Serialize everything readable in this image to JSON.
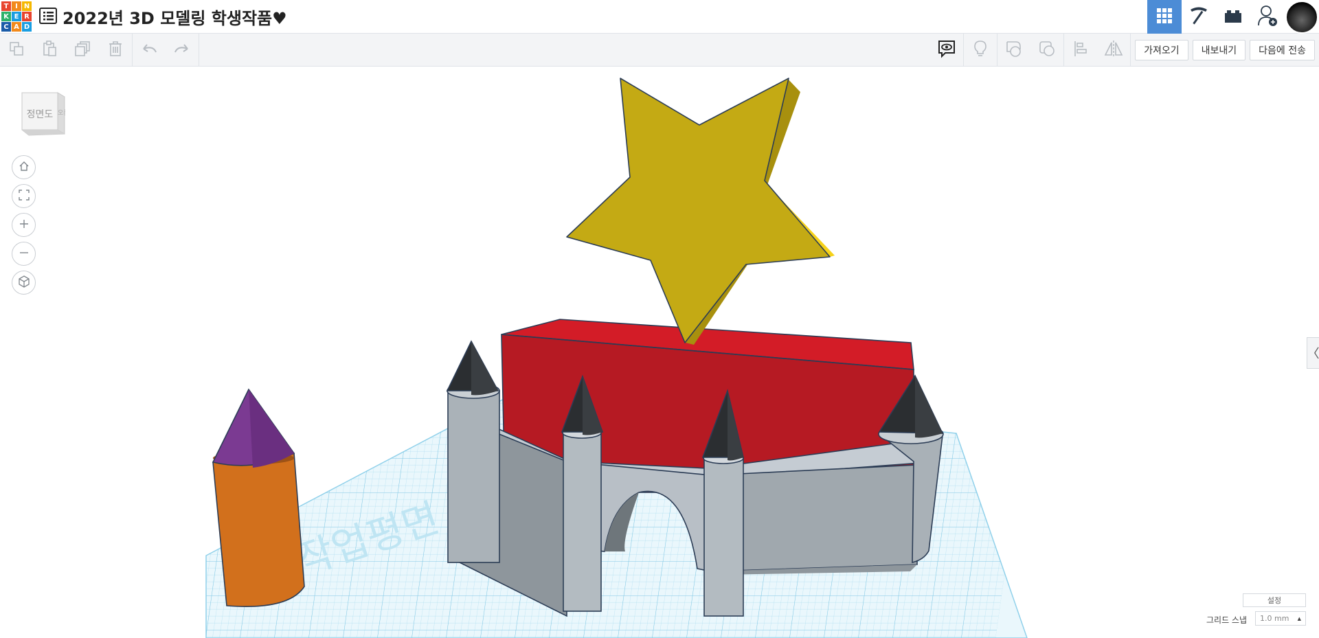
{
  "logo": {
    "letters": [
      "T",
      "I",
      "N",
      "K",
      "E",
      "R",
      "C",
      "A",
      "D"
    ],
    "colors": [
      "#e8442e",
      "#f28a1c",
      "#f5b800",
      "#2db26b",
      "#1a9ee2",
      "#e8442e",
      "#1a5ca8",
      "#f28a1c",
      "#1a9ee2"
    ]
  },
  "header": {
    "title": "2022년 3D 모델링 학생작품♥"
  },
  "toolbar": {
    "import_label": "가져오기",
    "export_label": "내보내기",
    "send_to_label": "다음에 전송"
  },
  "viewcube": {
    "face_label": "정면도",
    "side_label": "오른쪽"
  },
  "workplane": {
    "watermark": "작업평면"
  },
  "bottom": {
    "settings_label": "설정",
    "grid_snap_label": "그리드 스냅",
    "grid_snap_value": "1.0 mm"
  },
  "colors": {
    "accent": "#4c8cd6",
    "star": "#c4aa14",
    "box": "#b81a23",
    "castle": "#9ba3aa",
    "roof": "#2b2e31",
    "cone": "#7b3a92",
    "cylinder": "#d2701c",
    "grid": "#8fd0ea"
  }
}
